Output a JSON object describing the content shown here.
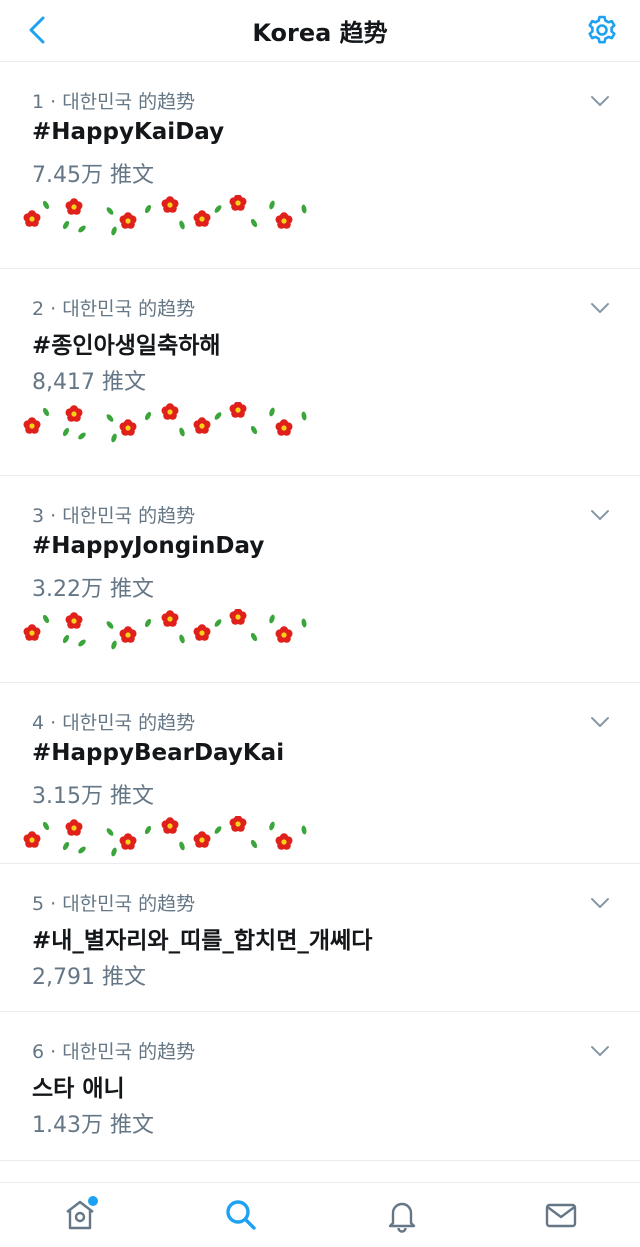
{
  "header": {
    "title": "Korea 趋势",
    "back_icon": "chevron-left-icon",
    "settings_icon": "gear-icon"
  },
  "colors": {
    "accent": "#1da1f2",
    "secondary_text": "#657786",
    "primary_text": "#14171a",
    "divider": "#e6ecf0",
    "flower_red": "#e0201b",
    "leaf_green": "#3aa53a"
  },
  "trends": [
    {
      "meta": "1 · 대한민국 的趋势",
      "tag": "#HappyKaiDay",
      "count": "7.45万 推文"
    },
    {
      "meta": "2 · 대한민국 的趋势",
      "tag": "#종인아생일축하해",
      "count": "8,417 推文"
    },
    {
      "meta": "3 · 대한민국 的趋势",
      "tag": "#HappyJonginDay",
      "count": "3.22万 推文"
    },
    {
      "meta": "4 · 대한민국 的趋势",
      "tag": "#HappyBearDayKai",
      "count": "3.15万 推文"
    },
    {
      "meta": "5 · 대한민국 的趋势",
      "tag": "#내_별자리와_띠를_합치면_개쎄다",
      "count": "2,791 推文"
    },
    {
      "meta": "6 · 대한민국 的趋势",
      "tag": "스타 애니",
      "count": "1.43万 推文"
    }
  ],
  "tabbar": {
    "items": [
      "home-icon",
      "search-icon",
      "notifications-icon",
      "messages-icon"
    ],
    "active": "search-icon"
  }
}
